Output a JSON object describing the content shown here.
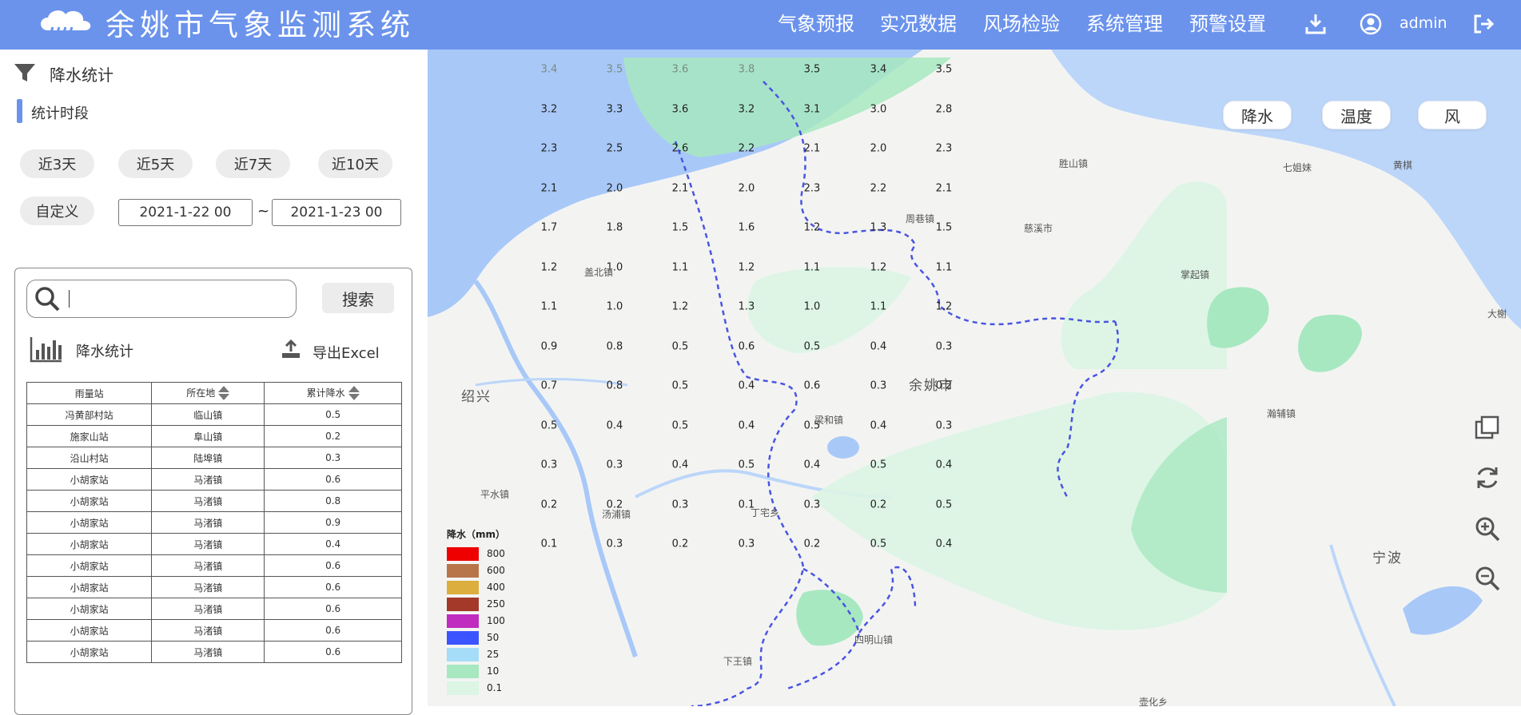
{
  "header": {
    "app_title": "余姚市气象监测系统",
    "nav": [
      "气象预报",
      "实况数据",
      "风场检验",
      "系统管理",
      "预警设置"
    ],
    "username": "admin"
  },
  "sidebar": {
    "filter_title": "降水统计",
    "period_label": "统计时段",
    "quick_ranges": [
      "近3天",
      "近5天",
      "近7天",
      "近10天"
    ],
    "custom_label": "自定义",
    "start_date": "2021-1-22 00",
    "date_separator": "~",
    "end_date": "2021-1-23 00",
    "search_button": "搜索",
    "stats_label": "降水统计",
    "export_label": "导出Excel",
    "table": {
      "columns": [
        "雨量站",
        "所在地",
        "累计降水"
      ],
      "rows": [
        [
          "冯黄部村站",
          "临山镇",
          "0.5"
        ],
        [
          "施家山站",
          "阜山镇",
          "0.2"
        ],
        [
          "沿山村站",
          "陆埠镇",
          "0.3"
        ],
        [
          "小胡家站",
          "马渚镇",
          "0.6"
        ],
        [
          "小胡家站",
          "马渚镇",
          "0.8"
        ],
        [
          "小胡家站",
          "马渚镇",
          "0.9"
        ],
        [
          "小胡家站",
          "马渚镇",
          "0.4"
        ],
        [
          "小胡家站",
          "马渚镇",
          "0.6"
        ],
        [
          "小胡家站",
          "马渚镇",
          "0.6"
        ],
        [
          "小胡家站",
          "马渚镇",
          "0.6"
        ],
        [
          "小胡家站",
          "马渚镇",
          "0.6"
        ],
        [
          "小胡家站",
          "马渚镇",
          "0.6"
        ]
      ]
    }
  },
  "map": {
    "layer_buttons": [
      "降水",
      "温度",
      "风"
    ],
    "city_label": "余姚市",
    "places": [
      "绍兴",
      "盖北镇",
      "周巷镇",
      "慈溪市",
      "胜山镇",
      "掌起镇",
      "七姐妹",
      "黄棋",
      "大榭",
      "平水镇",
      "汤浦镇",
      "丁宅乡",
      "梁和镇",
      "四明山镇",
      "下王镇",
      "宁波",
      "瀚辅镇",
      "壶化乡"
    ],
    "grid_values": [
      [
        "3.4",
        "3.5",
        "3.6",
        "3.8",
        "3.5",
        "3.4",
        "3.5"
      ],
      [
        "3.2",
        "3.3",
        "3.6",
        "3.2",
        "3.1",
        "3.0",
        "2.8"
      ],
      [
        "2.3",
        "2.5",
        "2.6",
        "2.2",
        "2.1",
        "2.0",
        "2.3"
      ],
      [
        "2.1",
        "2.0",
        "2.1",
        "2.0",
        "2.3",
        "2.2",
        "2.1"
      ],
      [
        "1.7",
        "1.8",
        "1.5",
        "1.6",
        "1.2",
        "1.3",
        "1.5"
      ],
      [
        "1.2",
        "1.0",
        "1.1",
        "1.2",
        "1.1",
        "1.2",
        "1.1"
      ],
      [
        "1.1",
        "1.0",
        "1.2",
        "1.3",
        "1.0",
        "1.1",
        "1.2"
      ],
      [
        "0.9",
        "0.8",
        "0.5",
        "0.6",
        "0.5",
        "0.4",
        "0.3"
      ],
      [
        "0.7",
        "0.8",
        "0.5",
        "0.4",
        "0.6",
        "0.3",
        "0.2"
      ],
      [
        "0.5",
        "0.4",
        "0.5",
        "0.4",
        "0.5",
        "0.4",
        "0.3"
      ],
      [
        "0.3",
        "0.3",
        "0.4",
        "0.5",
        "0.4",
        "0.5",
        "0.4"
      ],
      [
        "0.2",
        "0.2",
        "0.3",
        "0.1",
        "0.3",
        "0.2",
        "0.5"
      ],
      [
        "0.1",
        "0.3",
        "0.2",
        "0.3",
        "0.2",
        "0.5",
        "0.4"
      ]
    ],
    "legend": {
      "title": "降水（mm）",
      "items": [
        {
          "label": "800",
          "color": "#ee0000"
        },
        {
          "label": "600",
          "color": "#b8754a"
        },
        {
          "label": "400",
          "color": "#dcae3d"
        },
        {
          "label": "250",
          "color": "#a4392a"
        },
        {
          "label": "100",
          "color": "#c02bc0"
        },
        {
          "label": "50",
          "color": "#3c54ff"
        },
        {
          "label": "25",
          "color": "#a5dcf8"
        },
        {
          "label": "10",
          "color": "#a7e8c1"
        },
        {
          "label": "0.1",
          "color": "#dcf5e4"
        }
      ]
    }
  },
  "colors": {
    "header_bg": "#6b93ec",
    "accent": "#6b93ec",
    "water": "#a8c8f8",
    "boundary": "#4a55e0"
  }
}
